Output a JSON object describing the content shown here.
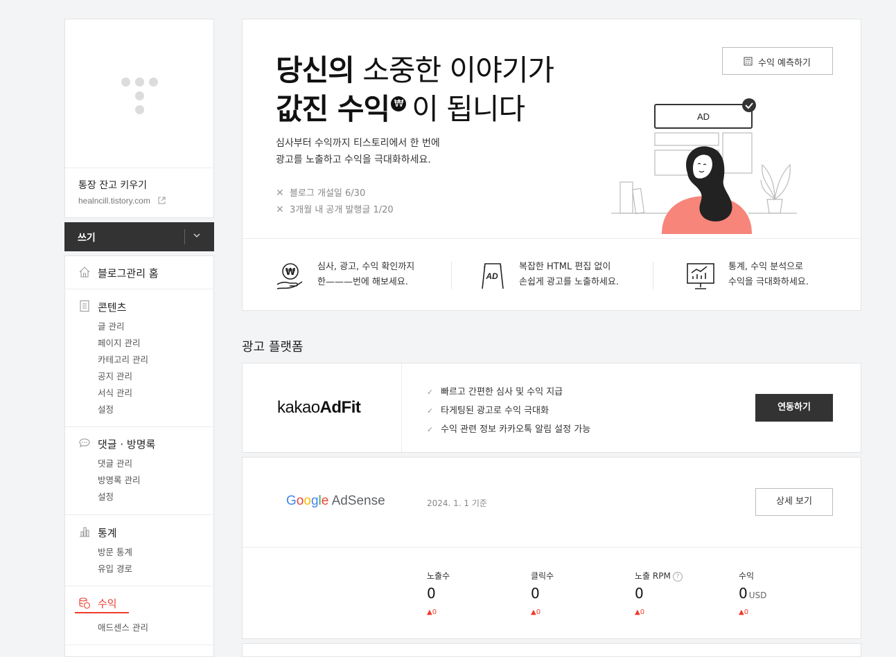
{
  "profile": {
    "blog_title": "통장 잔고 키우기",
    "blog_url": "healncill.tistory.com"
  },
  "write": {
    "label": "쓰기"
  },
  "menu": {
    "home": "블로그관리 홈",
    "content": {
      "title": "콘텐츠",
      "items": [
        "글 관리",
        "페이지 관리",
        "카테고리 관리",
        "공지 관리",
        "서식 관리",
        "설정"
      ]
    },
    "comments": {
      "title": "댓글 · 방명록",
      "items": [
        "댓글 관리",
        "방명록 관리",
        "설정"
      ]
    },
    "stats": {
      "title": "통계",
      "items": [
        "방문 통계",
        "유입 경로"
      ]
    },
    "revenue": {
      "title": "수익",
      "items": [
        "애드센스 관리"
      ]
    }
  },
  "hero": {
    "line1_bold": "당신의",
    "line1_rest": "소중한 이야기가",
    "line2_bold": "값진 수익",
    "won_symbol": "₩",
    "line2_rest": "이 됩니다",
    "desc1": "심사부터 수익까지 티스토리에서 한 번에",
    "desc2": "광고를 노출하고 수익을 극대화하세요.",
    "requirements": [
      "블로그 개설일 6/30",
      "3개월 내 공개 발행글 1/20"
    ],
    "predict_button": "수익 예측하기",
    "ad_label": "AD"
  },
  "features": [
    {
      "line1": "심사, 광고, 수익 확인까지",
      "line2": "한———번에 해보세요."
    },
    {
      "line1": "복잡한 HTML 편집 없이",
      "line2": "손쉽게 광고를 노출하세요."
    },
    {
      "line1": "통계, 수익 분석으로",
      "line2": "수익을 극대화하세요."
    }
  ],
  "platform_title": "광고 플랫폼",
  "adfit": {
    "logo_light": "kakao",
    "logo_bold": "AdFit",
    "bullets": [
      "빠르고 간편한 심사 및 수익 지급",
      "타게팅된 광고로 수익 극대화",
      "수익 관련 정보 카카오톡 알림 설정 가능"
    ],
    "connect_button": "연동하기"
  },
  "adsense": {
    "logo_google": "Google",
    "logo_adsense": "AdSense",
    "date": "2024. 1. 1 기준",
    "detail_button": "상세 보기",
    "stats": [
      {
        "label": "노출수",
        "value": "0",
        "unit": "",
        "change": "0"
      },
      {
        "label": "클릭수",
        "value": "0",
        "unit": "",
        "change": "0"
      },
      {
        "label": "노출 RPM",
        "value": "0",
        "unit": "",
        "change": "0"
      },
      {
        "label": "수익",
        "value": "0",
        "unit": "USD",
        "change": "0"
      }
    ]
  },
  "colors": {
    "accent": "#ee3b2b",
    "dark": "#333333",
    "pink": "#f7857a"
  }
}
